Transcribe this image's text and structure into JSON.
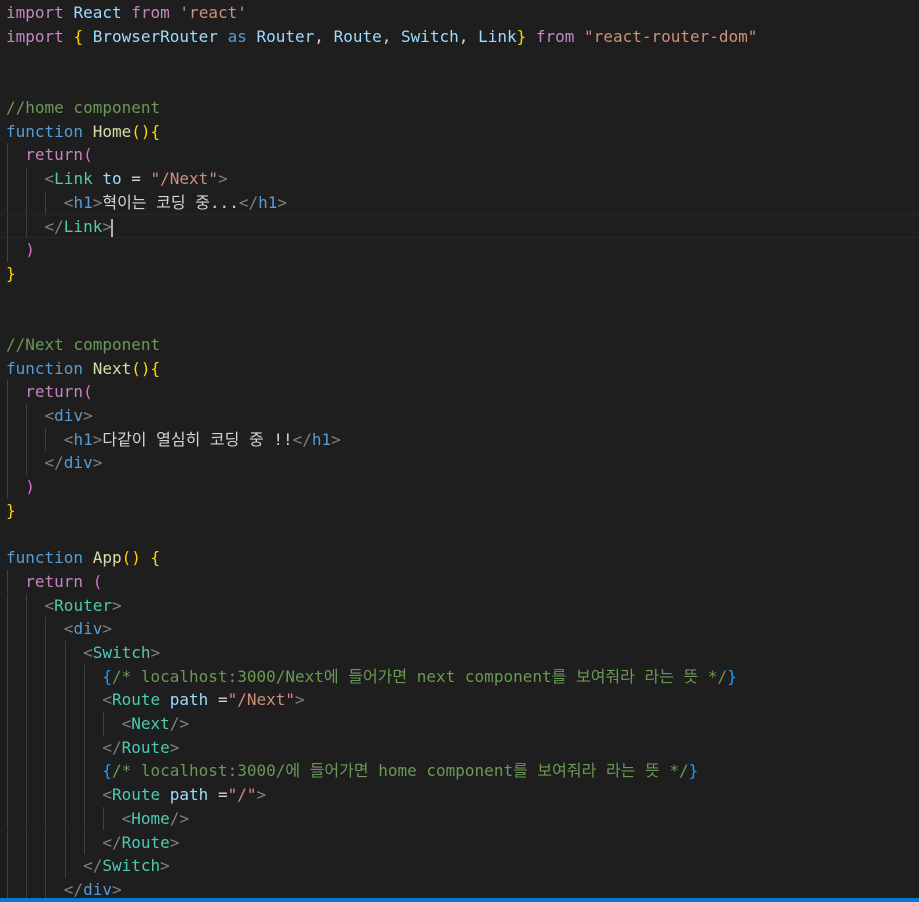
{
  "editor": {
    "lines": [
      [
        [
          "k1",
          "import"
        ],
        [
          "txt",
          " "
        ],
        [
          "id",
          "React"
        ],
        [
          "txt",
          " "
        ],
        [
          "k1",
          "from"
        ],
        [
          "txt",
          " "
        ],
        [
          "str",
          "'react'"
        ]
      ],
      [
        [
          "k1",
          "import"
        ],
        [
          "txt",
          " "
        ],
        [
          "br",
          "{"
        ],
        [
          "txt",
          " "
        ],
        [
          "id",
          "BrowserRouter"
        ],
        [
          "txt",
          " "
        ],
        [
          "k2",
          "as"
        ],
        [
          "txt",
          " "
        ],
        [
          "id",
          "Router"
        ],
        [
          "txt",
          ", "
        ],
        [
          "id",
          "Route"
        ],
        [
          "txt",
          ", "
        ],
        [
          "id",
          "Switch"
        ],
        [
          "txt",
          ", "
        ],
        [
          "id",
          "Link"
        ],
        [
          "br",
          "}"
        ],
        [
          "txt",
          " "
        ],
        [
          "k1",
          "from"
        ],
        [
          "txt",
          " "
        ],
        [
          "str",
          "\"react-router-dom\""
        ]
      ],
      [],
      [],
      [
        [
          "cm",
          "//home component"
        ]
      ],
      [
        [
          "k2",
          "function"
        ],
        [
          "txt",
          " "
        ],
        [
          "fn",
          "Home"
        ],
        [
          "br",
          "()"
        ],
        [
          "br",
          "{"
        ]
      ],
      [
        [
          "txt",
          "  "
        ],
        [
          "k1",
          "return"
        ],
        [
          "br2",
          "("
        ]
      ],
      [
        [
          "txt",
          "    "
        ],
        [
          "punc",
          "<"
        ],
        [
          "tag",
          "Link"
        ],
        [
          "txt",
          " "
        ],
        [
          "id",
          "to"
        ],
        [
          "txt",
          " = "
        ],
        [
          "str",
          "\"/Next\""
        ],
        [
          "punc",
          ">"
        ]
      ],
      [
        [
          "txt",
          "      "
        ],
        [
          "punc",
          "<"
        ],
        [
          "htag",
          "h1"
        ],
        [
          "punc",
          ">"
        ],
        [
          "txt",
          "혁이는 코딩 중..."
        ],
        [
          "punc",
          "</"
        ],
        [
          "htag",
          "h1"
        ],
        [
          "punc",
          ">"
        ]
      ],
      [
        [
          "txt",
          "    "
        ],
        [
          "punc",
          "</"
        ],
        [
          "tag",
          "Link"
        ],
        [
          "punc",
          ">"
        ]
      ],
      [
        [
          "txt",
          "  "
        ],
        [
          "br2",
          ")"
        ]
      ],
      [
        [
          "br",
          "}"
        ]
      ],
      [],
      [],
      [
        [
          "cm",
          "//Next component"
        ]
      ],
      [
        [
          "k2",
          "function"
        ],
        [
          "txt",
          " "
        ],
        [
          "fn",
          "Next"
        ],
        [
          "br",
          "()"
        ],
        [
          "br",
          "{"
        ]
      ],
      [
        [
          "txt",
          "  "
        ],
        [
          "k1",
          "return"
        ],
        [
          "br2",
          "("
        ]
      ],
      [
        [
          "txt",
          "    "
        ],
        [
          "punc",
          "<"
        ],
        [
          "htag",
          "div"
        ],
        [
          "punc",
          ">"
        ]
      ],
      [
        [
          "txt",
          "      "
        ],
        [
          "punc",
          "<"
        ],
        [
          "htag",
          "h1"
        ],
        [
          "punc",
          ">"
        ],
        [
          "txt",
          "다같이 열심히 코딩 중 !!"
        ],
        [
          "punc",
          "</"
        ],
        [
          "htag",
          "h1"
        ],
        [
          "punc",
          ">"
        ]
      ],
      [
        [
          "txt",
          "    "
        ],
        [
          "punc",
          "</"
        ],
        [
          "htag",
          "div"
        ],
        [
          "punc",
          ">"
        ]
      ],
      [
        [
          "txt",
          "  "
        ],
        [
          "br2",
          ")"
        ]
      ],
      [
        [
          "br",
          "}"
        ]
      ],
      [],
      [
        [
          "k2",
          "function"
        ],
        [
          "txt",
          " "
        ],
        [
          "fn",
          "App"
        ],
        [
          "br",
          "()"
        ],
        [
          "txt",
          " "
        ],
        [
          "br",
          "{"
        ]
      ],
      [
        [
          "txt",
          "  "
        ],
        [
          "k1",
          "return"
        ],
        [
          "txt",
          " "
        ],
        [
          "br2",
          "("
        ]
      ],
      [
        [
          "txt",
          "    "
        ],
        [
          "punc",
          "<"
        ],
        [
          "tag",
          "Router"
        ],
        [
          "punc",
          ">"
        ]
      ],
      [
        [
          "txt",
          "      "
        ],
        [
          "punc",
          "<"
        ],
        [
          "htag",
          "div"
        ],
        [
          "punc",
          ">"
        ]
      ],
      [
        [
          "txt",
          "        "
        ],
        [
          "punc",
          "<"
        ],
        [
          "tag",
          "Switch"
        ],
        [
          "punc",
          ">"
        ]
      ],
      [
        [
          "txt",
          "          "
        ],
        [
          "br3",
          "{"
        ],
        [
          "cm",
          "/* localhost:3000/Next에 들어가면 next component를 보여줘라 라는 뜻 */"
        ],
        [
          "br3",
          "}"
        ]
      ],
      [
        [
          "txt",
          "          "
        ],
        [
          "punc",
          "<"
        ],
        [
          "tag",
          "Route"
        ],
        [
          "txt",
          " "
        ],
        [
          "id",
          "path"
        ],
        [
          "txt",
          " ="
        ],
        [
          "str",
          "\"/Next\""
        ],
        [
          "punc",
          ">"
        ]
      ],
      [
        [
          "txt",
          "            "
        ],
        [
          "punc",
          "<"
        ],
        [
          "tag",
          "Next"
        ],
        [
          "punc",
          "/>"
        ]
      ],
      [
        [
          "txt",
          "          "
        ],
        [
          "punc",
          "</"
        ],
        [
          "tag",
          "Route"
        ],
        [
          "punc",
          ">"
        ]
      ],
      [
        [
          "txt",
          "          "
        ],
        [
          "br3",
          "{"
        ],
        [
          "cm",
          "/* localhost:3000/에 들어가면 home component를 보여줘라 라는 뜻 */"
        ],
        [
          "br3",
          "}"
        ]
      ],
      [
        [
          "txt",
          "          "
        ],
        [
          "punc",
          "<"
        ],
        [
          "tag",
          "Route"
        ],
        [
          "txt",
          " "
        ],
        [
          "id",
          "path"
        ],
        [
          "txt",
          " ="
        ],
        [
          "str",
          "\"/\""
        ],
        [
          "punc",
          ">"
        ]
      ],
      [
        [
          "txt",
          "            "
        ],
        [
          "punc",
          "<"
        ],
        [
          "tag",
          "Home"
        ],
        [
          "punc",
          "/>"
        ]
      ],
      [
        [
          "txt",
          "          "
        ],
        [
          "punc",
          "</"
        ],
        [
          "tag",
          "Route"
        ],
        [
          "punc",
          ">"
        ]
      ],
      [
        [
          "txt",
          "        "
        ],
        [
          "punc",
          "</"
        ],
        [
          "tag",
          "Switch"
        ],
        [
          "punc",
          ">"
        ]
      ],
      [
        [
          "txt",
          "      "
        ],
        [
          "punc",
          "</"
        ],
        [
          "htag",
          "div"
        ],
        [
          "punc",
          ">"
        ]
      ]
    ],
    "current_line": 9
  }
}
